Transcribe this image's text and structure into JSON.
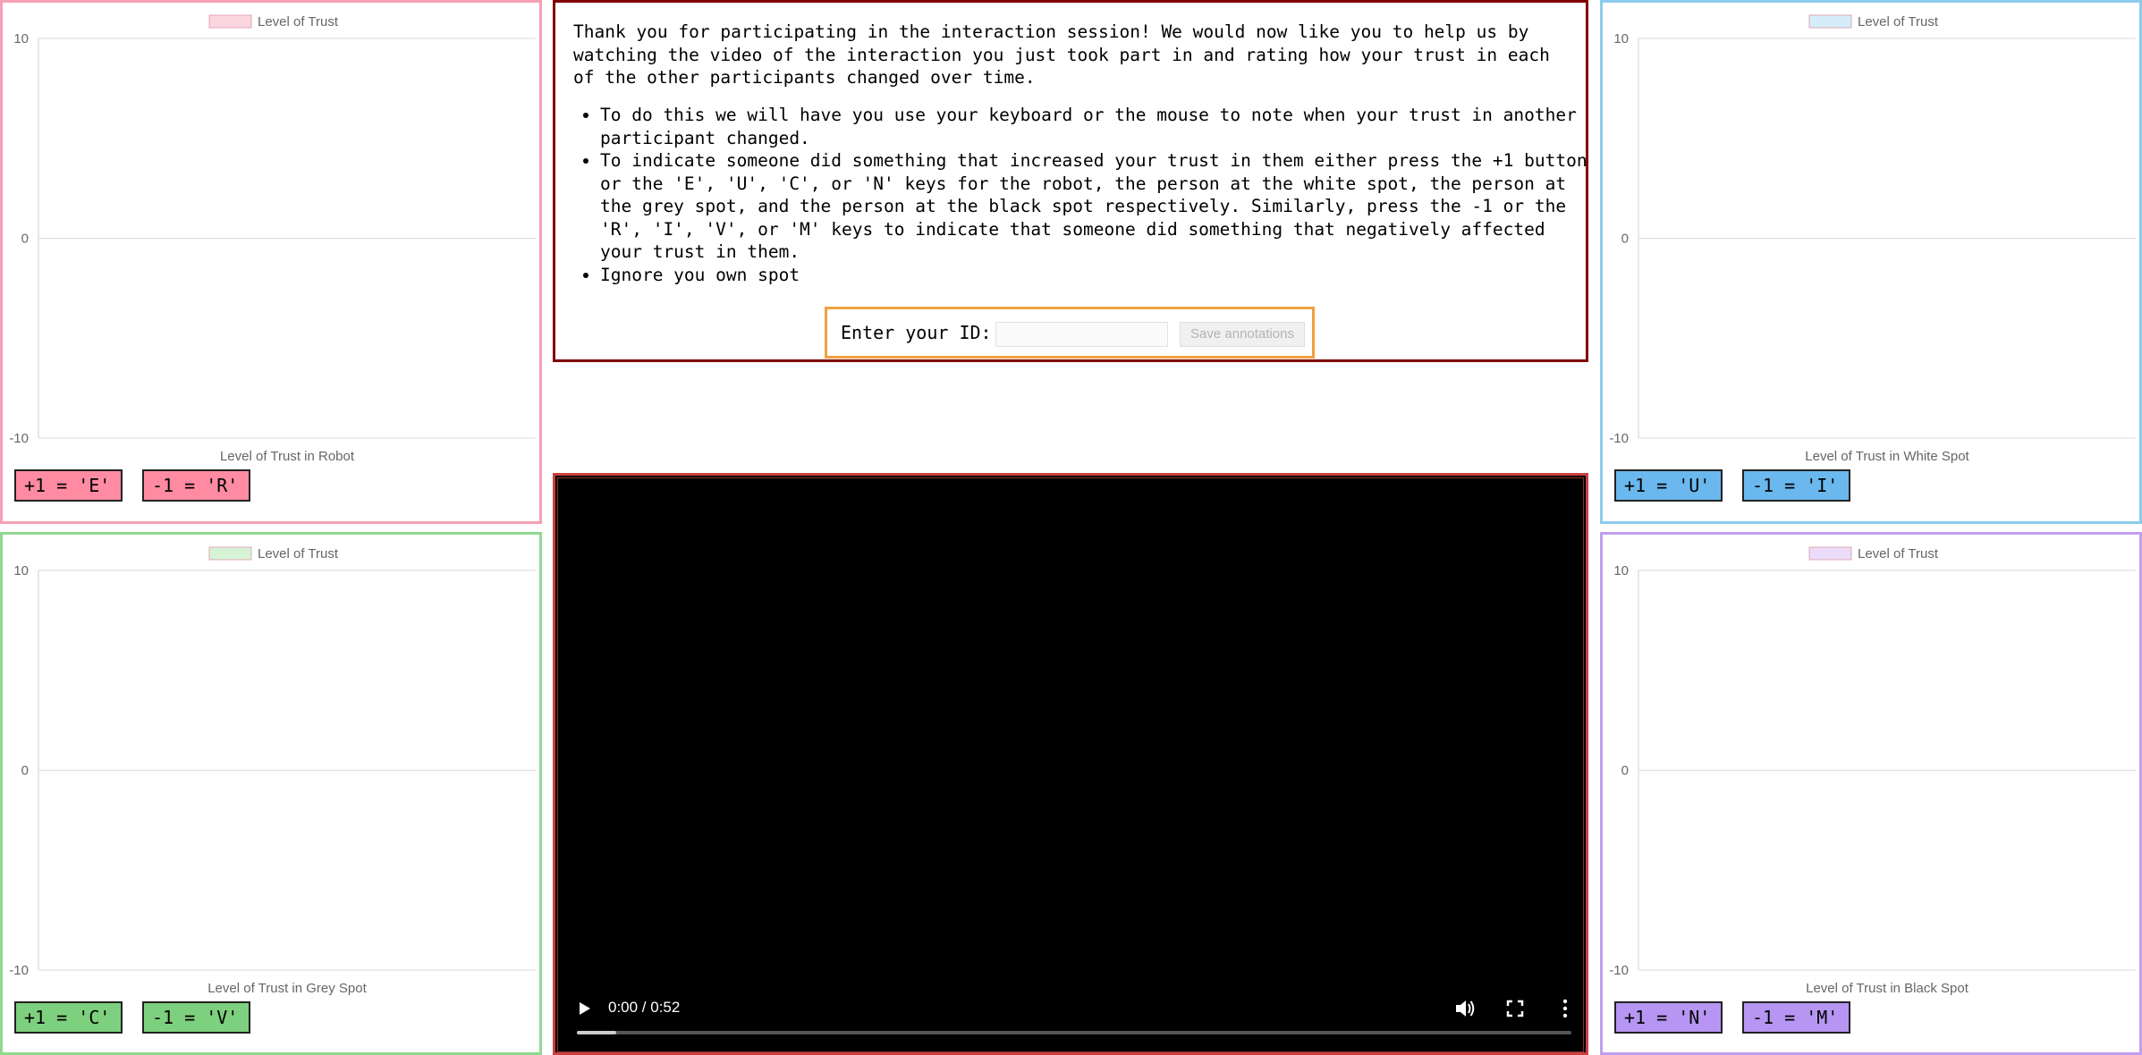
{
  "instructions": {
    "intro": "Thank you for participating in the interaction session! We would now like you to help us by watching the video of the interaction you just took part in and rating how your trust in each of the other participants changed over time.",
    "bullets": [
      "To do this we will have you use your keyboard or the mouse to note when your trust in another participant changed.",
      "To indicate someone did something that increased your trust in them either press the +1 button or the 'E', 'U', 'C', or 'N' keys for the robot, the person at the white spot, the person at the grey spot, and the person at the black spot respectively. Similarly, press the -1 or the 'R', 'I', 'V', or 'M' keys to indicate that someone did something that negatively affected your trust in them.",
      "Ignore you own spot"
    ],
    "id_label": "Enter your ID:",
    "id_value": "",
    "save_label": "Save annotations"
  },
  "video": {
    "time": "0:00 / 0:52",
    "progress": 0.04
  },
  "panels": {
    "robot": {
      "plus": "+1 = 'E'",
      "minus": "-1 = 'R'",
      "color": "#ff8ba3",
      "border": "#f4a0b5"
    },
    "white": {
      "plus": "+1 = 'U'",
      "minus": "-1 = 'I'",
      "color": "#6bb8ee",
      "border": "#8ccbec"
    },
    "grey": {
      "plus": "+1 = 'C'",
      "minus": "-1 = 'V'",
      "color": "#7dd07d",
      "border": "#90d890"
    },
    "black": {
      "plus": "+1 = 'N'",
      "minus": "-1 = 'M'",
      "color": "#b696f2",
      "border": "#c0a0ee"
    }
  },
  "chart_data": [
    {
      "type": "line",
      "title": "",
      "legend": "Level of Trust",
      "legend_color": "#f9d5de",
      "xlabel": "Level of Trust in Robot",
      "ylabel": "",
      "ylim": [
        -10,
        10
      ],
      "y_ticks": [
        "10",
        "0",
        "-10"
      ],
      "grid": true,
      "series": [
        {
          "name": "Level of Trust",
          "values": []
        }
      ]
    },
    {
      "type": "line",
      "title": "",
      "legend": "Level of Trust",
      "legend_color": "#d4edf9",
      "xlabel": "Level of Trust in White Spot",
      "ylabel": "",
      "ylim": [
        -10,
        10
      ],
      "y_ticks": [
        "10",
        "0",
        "-10"
      ],
      "grid": true,
      "series": [
        {
          "name": "Level of Trust",
          "values": []
        }
      ]
    },
    {
      "type": "line",
      "title": "",
      "legend": "Level of Trust",
      "legend_color": "#d6f3d6",
      "xlabel": "Level of Trust in Grey Spot",
      "ylabel": "",
      "ylim": [
        -10,
        10
      ],
      "y_ticks": [
        "10",
        "0",
        "-10"
      ],
      "grid": true,
      "series": [
        {
          "name": "Level of Trust",
          "values": []
        }
      ]
    },
    {
      "type": "line",
      "title": "",
      "legend": "Level of Trust",
      "legend_color": "#ebdcfa",
      "xlabel": "Level of Trust in Black Spot",
      "ylabel": "",
      "ylim": [
        -10,
        10
      ],
      "y_ticks": [
        "10",
        "0",
        "-10"
      ],
      "grid": true,
      "series": [
        {
          "name": "Level of Trust",
          "values": []
        }
      ]
    }
  ]
}
